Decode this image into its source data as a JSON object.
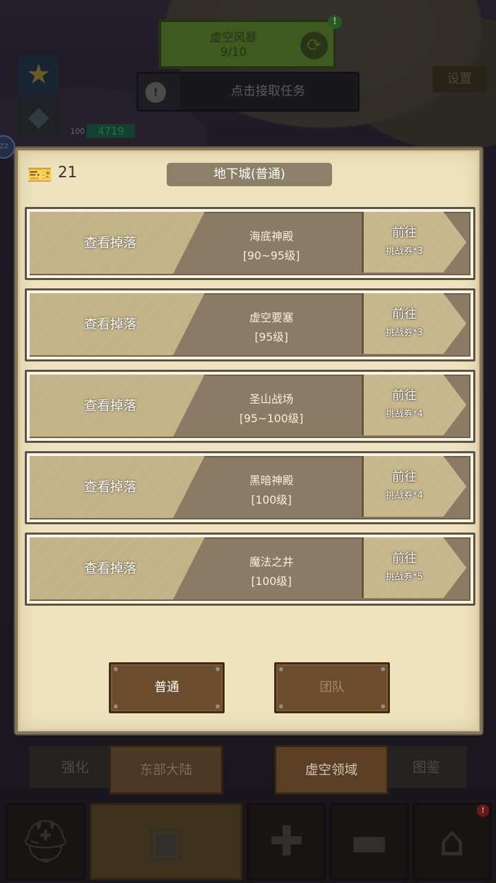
{
  "hud": {
    "quest_name": "虚空风暴",
    "quest_progress": "9/10",
    "quest_alert": "!",
    "accept_text": "点击接取任务",
    "accept_icon": "!",
    "settings_label": "设置",
    "level": "100",
    "exp_value": "4719",
    "side_bubble": "22"
  },
  "dialog": {
    "ticket_count": "21",
    "title": "地下城(普通)",
    "dungeons": [
      {
        "loot_label": "查看掉落",
        "name": "海底神殿",
        "level": "[90~95级]",
        "go_label": "前往",
        "cost": "挑战券*3"
      },
      {
        "loot_label": "查看掉落",
        "name": "虚空要塞",
        "level": "[95级]",
        "go_label": "前往",
        "cost": "挑战券*3"
      },
      {
        "loot_label": "查看掉落",
        "name": "圣山战场",
        "level": "[95~100级]",
        "go_label": "前往",
        "cost": "挑战券*4"
      },
      {
        "loot_label": "查看掉落",
        "name": "黑暗神殿",
        "level": "[100级]",
        "go_label": "前往",
        "cost": "挑战券*4"
      },
      {
        "loot_label": "查看掉落",
        "name": "魔法之井",
        "level": "[100级]",
        "go_label": "前往",
        "cost": "挑战券*5"
      }
    ],
    "mode_normal": "普通",
    "mode_team": "团队"
  },
  "bottom_tabs": {
    "enhance": "强化",
    "east_continent": "东部大陆",
    "void_realm": "虚空领域",
    "codex": "图鉴"
  },
  "nav": {
    "alert": "!",
    "items": [
      "helmet-icon",
      "armor-icon",
      "altar-icon",
      "anvil-icon",
      "shop-icon"
    ]
  },
  "colors": {
    "panel": "#efe3bf",
    "row_fill": "#8c7b64",
    "parchment_tab": "#c3b389",
    "wood_button": "#6b4c2d",
    "title_bar": "#8b8169"
  }
}
